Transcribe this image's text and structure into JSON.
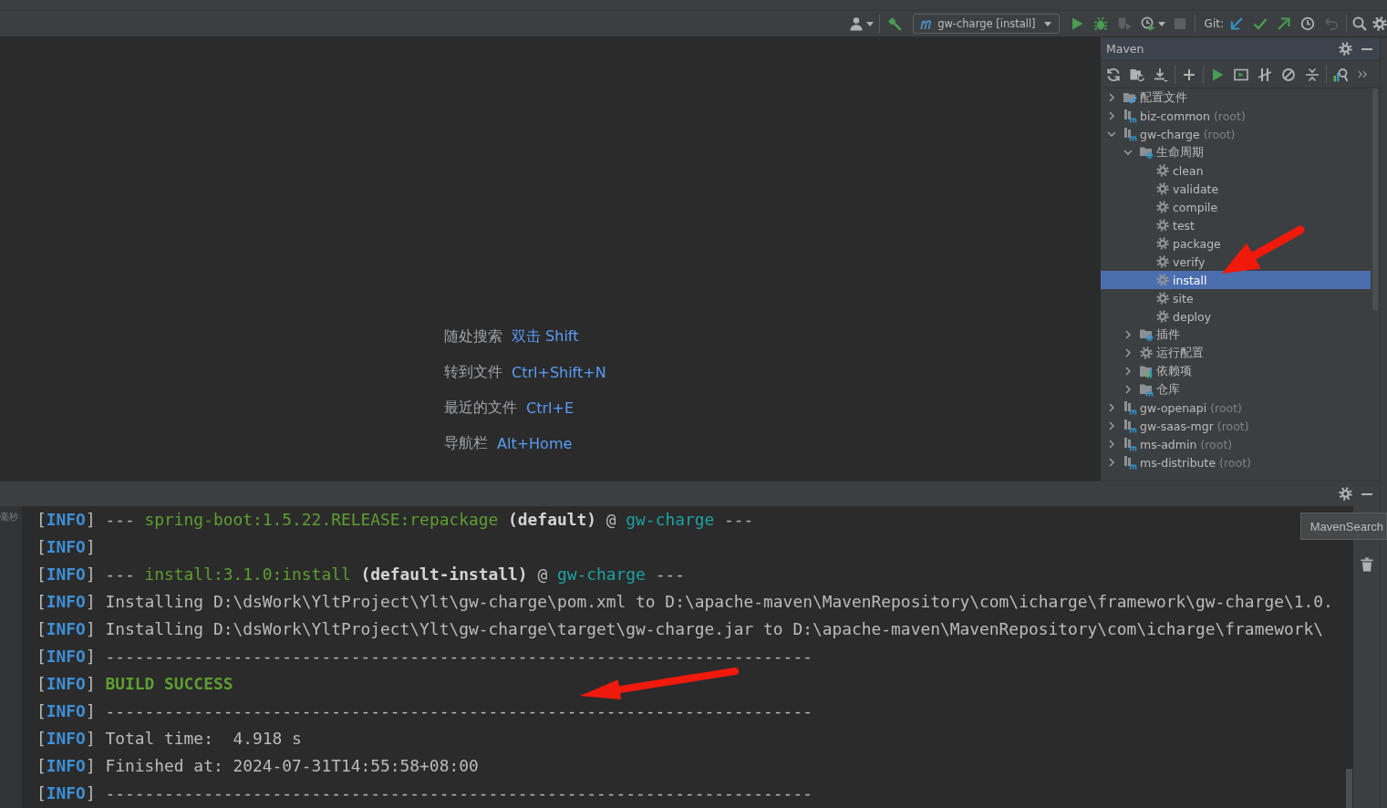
{
  "toolbar": {
    "groups": [
      [
        {
          "kind": "user",
          "disabled": false
        }
      ],
      [
        {
          "kind": "build",
          "disabled": false
        },
        {
          "kind": "run-config",
          "label": "gw-charge [install]"
        },
        {
          "kind": "run",
          "disabled": false
        },
        {
          "kind": "debug",
          "disabled": false
        },
        {
          "kind": "coverage",
          "disabled": true
        },
        {
          "kind": "profile",
          "disabled": false
        },
        {
          "kind": "stop",
          "disabled": true
        }
      ],
      [
        {
          "kind": "label",
          "text": "Git:"
        },
        {
          "kind": "update",
          "disabled": false
        },
        {
          "kind": "commit",
          "disabled": false
        },
        {
          "kind": "push",
          "disabled": false
        },
        {
          "kind": "history",
          "disabled": false
        },
        {
          "kind": "rollback",
          "disabled": true
        }
      ],
      [
        {
          "kind": "search",
          "disabled": false
        },
        {
          "kind": "settings",
          "disabled": false
        }
      ]
    ]
  },
  "editor": {
    "hints": [
      {
        "label": "随处搜索",
        "shortcut": "双击 Shift"
      },
      {
        "label": "转到文件",
        "shortcut": "Ctrl+Shift+N"
      },
      {
        "label": "最近的文件",
        "shortcut": "Ctrl+E"
      },
      {
        "label": "导航栏",
        "shortcut": "Alt+Home"
      }
    ]
  },
  "maven": {
    "title": "Maven",
    "tree": [
      {
        "kind": "profiles",
        "label": "配置文件",
        "expanded": false,
        "selected": false
      },
      {
        "kind": "module",
        "label": "biz-common",
        "note": "(root)",
        "expanded": false,
        "selected": false
      },
      {
        "kind": "module",
        "label": "gw-charge",
        "note": "(root)",
        "expanded": true,
        "selected": false,
        "children": [
          {
            "kind": "lifecycle",
            "label": "生命周期",
            "expanded": true,
            "selected": false,
            "children": [
              {
                "kind": "goal",
                "label": "clean",
                "selected": false
              },
              {
                "kind": "goal",
                "label": "validate",
                "selected": false
              },
              {
                "kind": "goal",
                "label": "compile",
                "selected": false
              },
              {
                "kind": "goal",
                "label": "test",
                "selected": false
              },
              {
                "kind": "goal",
                "label": "package",
                "selected": false
              },
              {
                "kind": "goal",
                "label": "verify",
                "selected": false
              },
              {
                "kind": "goal",
                "label": "install",
                "selected": true
              },
              {
                "kind": "goal",
                "label": "site",
                "selected": false
              },
              {
                "kind": "goal",
                "label": "deploy",
                "selected": false
              }
            ]
          },
          {
            "kind": "plugins",
            "label": "插件",
            "expanded": false,
            "selected": false
          },
          {
            "kind": "run-configs",
            "label": "运行配置",
            "expanded": false,
            "selected": false
          },
          {
            "kind": "dependencies",
            "label": "依赖项",
            "expanded": false,
            "selected": false
          },
          {
            "kind": "repositories",
            "label": "仓库",
            "expanded": false,
            "selected": false
          }
        ]
      },
      {
        "kind": "module",
        "label": "gw-openapi",
        "note": "(root)",
        "expanded": false,
        "selected": false
      },
      {
        "kind": "module",
        "label": "gw-saas-mgr",
        "note": "(root)",
        "expanded": false,
        "selected": false
      },
      {
        "kind": "module",
        "label": "ms-admin",
        "note": "(root)",
        "expanded": false,
        "selected": false
      },
      {
        "kind": "module",
        "label": "ms-distribute",
        "note": "(root)",
        "expanded": false,
        "selected": false
      }
    ]
  },
  "run": {
    "gutter_note": "毫秒",
    "lines": [
      {
        "parts": [
          {
            "kind": "plain",
            "text": "["
          },
          {
            "kind": "level",
            "text": "INFO"
          },
          {
            "kind": "plain",
            "text": "] --- "
          },
          {
            "kind": "goal",
            "text": "spring-boot:1.5.22.RELEASE:repackage"
          },
          {
            "kind": "bold",
            "text": " (default)"
          },
          {
            "kind": "plain",
            "text": " @ "
          },
          {
            "kind": "project",
            "text": "gw-charge"
          },
          {
            "kind": "plain",
            "text": " ---"
          }
        ]
      },
      {
        "parts": [
          {
            "kind": "plain",
            "text": "["
          },
          {
            "kind": "level",
            "text": "INFO"
          },
          {
            "kind": "plain",
            "text": "]"
          }
        ]
      },
      {
        "parts": [
          {
            "kind": "plain",
            "text": "["
          },
          {
            "kind": "level",
            "text": "INFO"
          },
          {
            "kind": "plain",
            "text": "] --- "
          },
          {
            "kind": "goal",
            "text": "install:3.1.0:install"
          },
          {
            "kind": "bold",
            "text": " (default-install)"
          },
          {
            "kind": "plain",
            "text": " @ "
          },
          {
            "kind": "project",
            "text": "gw-charge"
          },
          {
            "kind": "plain",
            "text": " ---"
          }
        ]
      },
      {
        "parts": [
          {
            "kind": "plain",
            "text": "["
          },
          {
            "kind": "level",
            "text": "INFO"
          },
          {
            "kind": "plain",
            "text": "] Installing D:\\dsWork\\YltProject\\Ylt\\gw-charge\\pom.xml to D:\\apache-maven\\MavenRepository\\com\\icharge\\framework\\gw-charge\\1.0."
          }
        ]
      },
      {
        "parts": [
          {
            "kind": "plain",
            "text": "["
          },
          {
            "kind": "level",
            "text": "INFO"
          },
          {
            "kind": "plain",
            "text": "] Installing D:\\dsWork\\YltProject\\Ylt\\gw-charge\\target\\gw-charge.jar to D:\\apache-maven\\MavenRepository\\com\\icharge\\framework\\"
          }
        ]
      },
      {
        "parts": [
          {
            "kind": "plain",
            "text": "["
          },
          {
            "kind": "level",
            "text": "INFO"
          },
          {
            "kind": "plain",
            "text": "] ------------------------------------------------------------------------"
          }
        ]
      },
      {
        "parts": [
          {
            "kind": "plain",
            "text": "["
          },
          {
            "kind": "level",
            "text": "INFO"
          },
          {
            "kind": "plain",
            "text": "] "
          },
          {
            "kind": "success",
            "text": "BUILD SUCCESS"
          }
        ]
      },
      {
        "parts": [
          {
            "kind": "plain",
            "text": "["
          },
          {
            "kind": "level",
            "text": "INFO"
          },
          {
            "kind": "plain",
            "text": "] ------------------------------------------------------------------------"
          }
        ]
      },
      {
        "parts": [
          {
            "kind": "plain",
            "text": "["
          },
          {
            "kind": "level",
            "text": "INFO"
          },
          {
            "kind": "plain",
            "text": "] Total time:  4.918 s"
          }
        ]
      },
      {
        "parts": [
          {
            "kind": "plain",
            "text": "["
          },
          {
            "kind": "level",
            "text": "INFO"
          },
          {
            "kind": "plain",
            "text": "] Finished at: 2024-07-31T14:55:58+08:00"
          }
        ]
      },
      {
        "parts": [
          {
            "kind": "plain",
            "text": "["
          },
          {
            "kind": "level",
            "text": "INFO"
          },
          {
            "kind": "plain",
            "text": "] ------------------------------------------------------------------------"
          }
        ]
      }
    ]
  },
  "tooltip": "MavenSearch"
}
